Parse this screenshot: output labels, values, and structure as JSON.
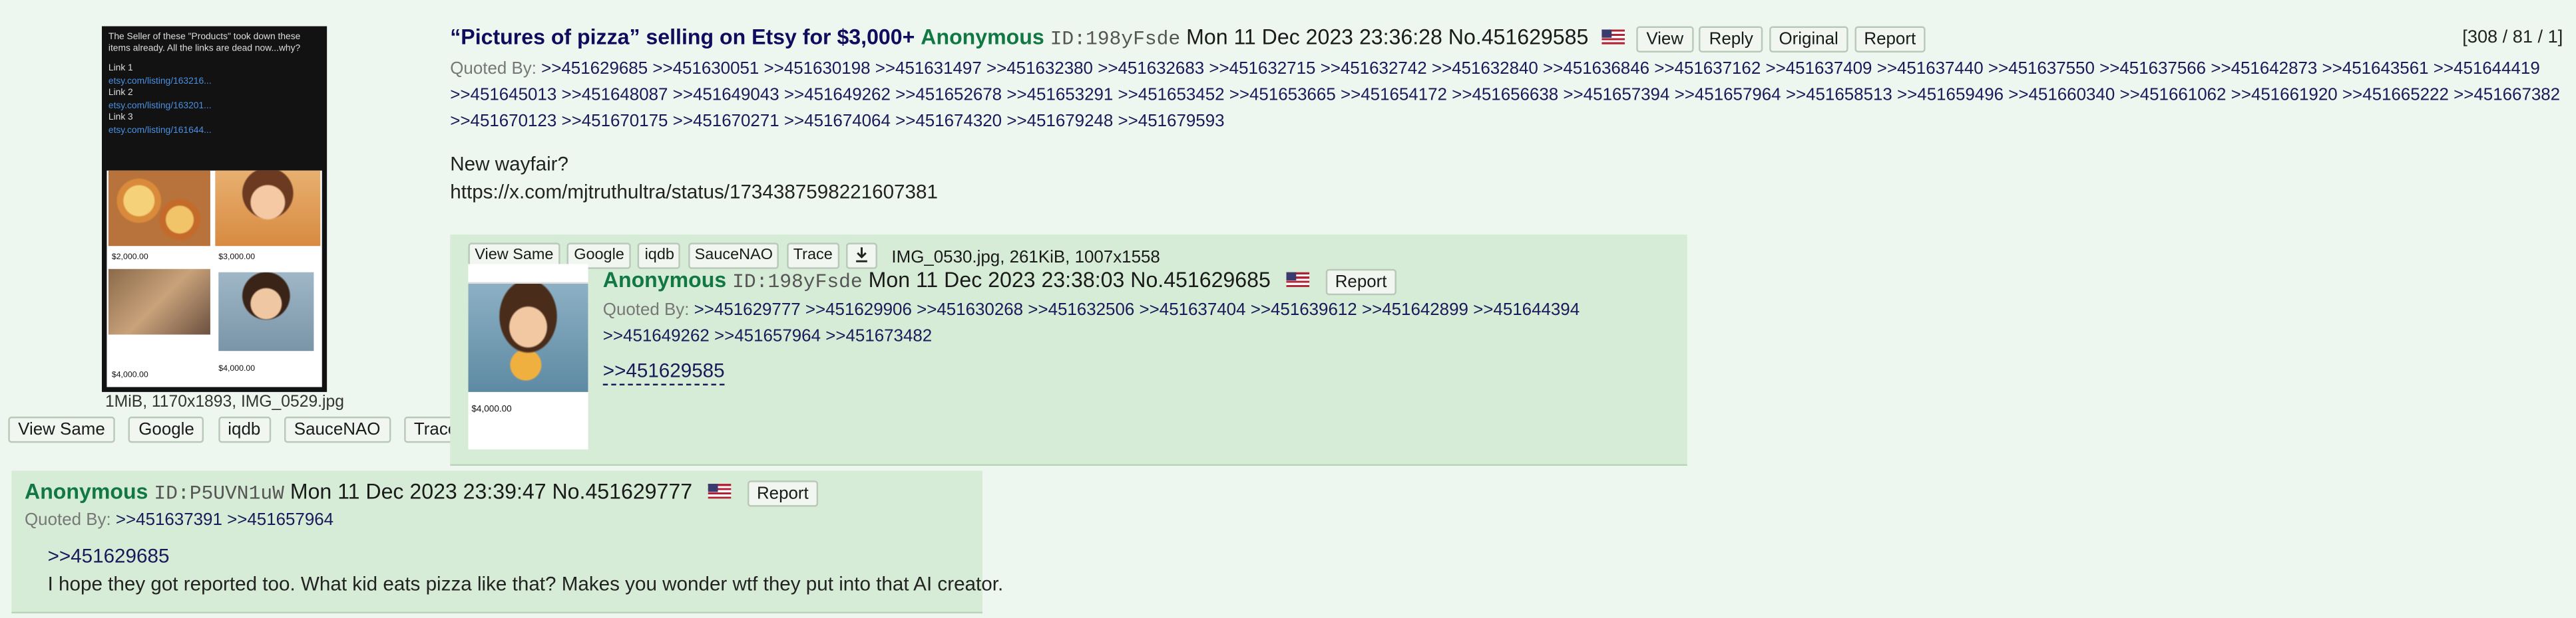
{
  "op": {
    "thumb": {
      "top_text": "The Seller of these \"Products\" took down these items already. All the links are dead now...why?",
      "links": [
        {
          "label": "Link 1",
          "url": "etsy.com/listing/163216..."
        },
        {
          "label": "Link 2",
          "url": "etsy.com/listing/163201..."
        },
        {
          "label": "Link 3",
          "url": "etsy.com/listing/161644..."
        }
      ],
      "prices": [
        "$2,000.00",
        "$3,000.00",
        "$4,000.00",
        "$4,000.00"
      ]
    },
    "file_info": "1MiB, 1170x1893, IMG_0529.jpg",
    "file_buttons": [
      "View Same",
      "Google",
      "iqdb",
      "SauceNAO",
      "Trace"
    ],
    "subject": "“Pictures of pizza” selling on Etsy for $3,000+",
    "name": "Anonymous",
    "id": "ID:198yFsde",
    "datetime": "Mon 11 Dec 2023 23:36:28",
    "post_no": "No.451629585",
    "action_buttons": [
      "View",
      "Reply",
      "Original",
      "Report"
    ],
    "counts": "[308 / 81 / 1]",
    "quoted_by_label": "Quoted By:",
    "quoted_by": [
      ">>451629685",
      ">>451630051",
      ">>451630198",
      ">>451631497",
      ">>451632380",
      ">>451632683",
      ">>451632715",
      ">>451632742",
      ">>451632840",
      ">>451636846",
      ">>451637162",
      ">>451637409",
      ">>451637440",
      ">>451637550",
      ">>451637566",
      ">>451642873",
      ">>451643561",
      ">>451644419",
      ">>451645013",
      ">>451648087",
      ">>451649043",
      ">>451649262",
      ">>451652678",
      ">>451653291",
      ">>451653452",
      ">>451653665",
      ">>451654172",
      ">>451656638",
      ">>451657394",
      ">>451657964",
      ">>451658513",
      ">>451659496",
      ">>451660340",
      ">>451661062",
      ">>451661920",
      ">>451665222",
      ">>451667382",
      ">>451670123",
      ">>451670175",
      ">>451670271",
      ">>451674064",
      ">>451674320",
      ">>451679248",
      ">>451679593"
    ],
    "body_line1": "New wayfair?",
    "body_line2": "https://x.com/mjtruthultra/status/1734387598221607381"
  },
  "reply1": {
    "file_buttons": [
      "View Same",
      "Google",
      "iqdb",
      "SauceNAO",
      "Trace"
    ],
    "file_info": "IMG_0530.jpg, 261KiB, 1007x1558",
    "thumb_price": "$4,000.00",
    "name": "Anonymous",
    "id": "ID:198yFsde",
    "datetime": "Mon 11 Dec 2023 23:38:03",
    "post_no": "No.451629685",
    "report": "Report",
    "quoted_by_label": "Quoted By:",
    "quoted_by": [
      ">>451629777",
      ">>451629906",
      ">>451630268",
      ">>451632506",
      ">>451637404",
      ">>451639612",
      ">>451642899",
      ">>451644394",
      ">>451649262",
      ">>451657964",
      ">>451673482"
    ],
    "body_quote": ">>451629585"
  },
  "reply2": {
    "name": "Anonymous",
    "id": "ID:P5UVN1uW",
    "datetime": "Mon 11 Dec 2023 23:39:47",
    "post_no": "No.451629777",
    "report": "Report",
    "quoted_by_label": "Quoted By:",
    "quoted_by": [
      ">>451637391",
      ">>451657964"
    ],
    "body_quote": ">>451629685",
    "body_text": "I hope they got reported too. What kid eats pizza like that? Makes you wonder wtf they put into that AI creator."
  }
}
